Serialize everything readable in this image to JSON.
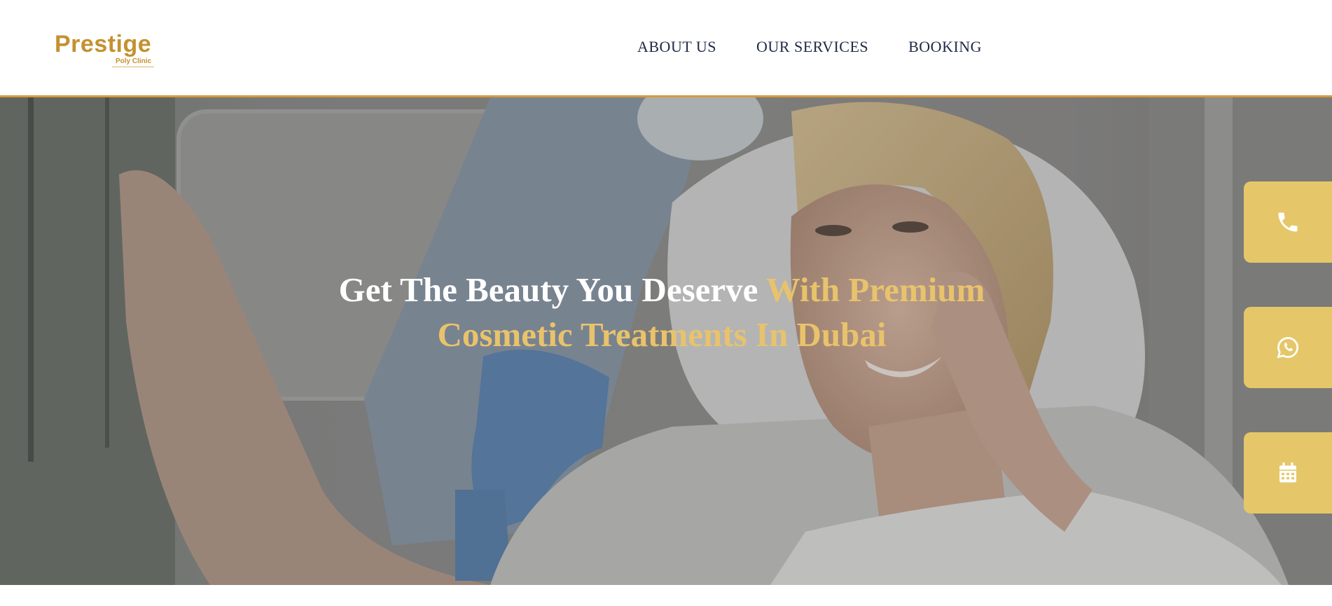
{
  "header": {
    "logo": {
      "wordmark": "Prestige",
      "subtitle": "Poly Clinic"
    },
    "nav": [
      {
        "label": "ABOUT US"
      },
      {
        "label": "OUR SERVICES"
      },
      {
        "label": "BOOKING"
      }
    ],
    "accent_border_color": "#d99a3e"
  },
  "hero": {
    "title_white": "Get The Beauty You Deserve ",
    "title_gold_1": "With Premium",
    "title_gold_2": "Cosmetic Treatments In Dubai",
    "gold_color": "#e8c36c"
  },
  "floating_actions": [
    {
      "icon": "phone-icon"
    },
    {
      "icon": "whatsapp-icon"
    },
    {
      "icon": "calendar-icon"
    }
  ],
  "colors": {
    "brand_gold": "#c4912f",
    "fab_background": "#e5c769",
    "nav_text": "#1e2a44"
  }
}
